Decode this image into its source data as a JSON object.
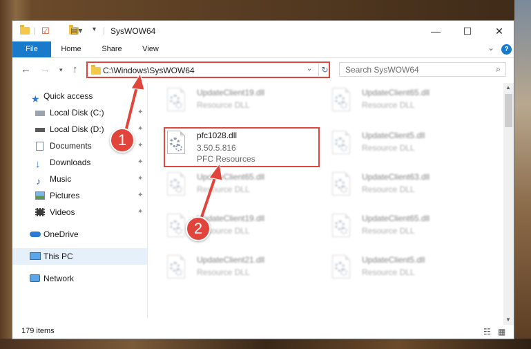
{
  "window": {
    "title": "SysWOW64",
    "controls": {
      "minimize": "—",
      "maximize": "☐",
      "close": "✕"
    }
  },
  "ribbon": {
    "tabs": [
      "File",
      "Home",
      "Share",
      "View"
    ],
    "help": "?",
    "collapse": "⌄"
  },
  "address": {
    "path": "C:\\Windows\\SysWOW64",
    "refresh": "↻",
    "dropdown": "⌄"
  },
  "search": {
    "placeholder": "Search SysWOW64",
    "icon": "⌕"
  },
  "sidebar": {
    "items": [
      {
        "label": "Quick access",
        "icon": "star-icon",
        "pinned": false
      },
      {
        "label": "Local Disk (C:)",
        "icon": "drive-icon",
        "pinned": true
      },
      {
        "label": "Local Disk (D:)",
        "icon": "drive-icon",
        "pinned": true
      },
      {
        "label": "Documents",
        "icon": "documents-icon",
        "pinned": true
      },
      {
        "label": "Downloads",
        "icon": "download-icon",
        "pinned": true
      },
      {
        "label": "Music",
        "icon": "music-icon",
        "pinned": true
      },
      {
        "label": "Pictures",
        "icon": "pictures-icon",
        "pinned": true
      },
      {
        "label": "Videos",
        "icon": "videos-icon",
        "pinned": true
      },
      {
        "label": "OneDrive",
        "icon": "onedrive-icon",
        "pinned": false
      },
      {
        "label": "This PC",
        "icon": "computer-icon",
        "pinned": false,
        "selected": true
      },
      {
        "label": "Network",
        "icon": "network-icon",
        "pinned": false
      }
    ],
    "pin_glyph": "📌"
  },
  "files": {
    "col1": [
      {
        "name": "UpdateClient19.dll",
        "type": "Resource DLL",
        "blurred": true
      },
      {
        "name": "pfc1028.dll",
        "version": "3.50.5.816",
        "type": "PFC Resources",
        "blurred": false
      },
      {
        "name": "UpdateClient65.dll",
        "type": "Resource DLL",
        "blurred": true
      },
      {
        "name": "UpdateClient19.dll",
        "type": "Resource DLL",
        "blurred": true
      },
      {
        "name": "UpdateClient21.dll",
        "type": "Resource DLL",
        "blurred": true
      }
    ],
    "col2": [
      {
        "name": "UpdateClient65.dll",
        "type": "Resource DLL",
        "blurred": true
      },
      {
        "name": "UpdateClient5.dll",
        "type": "Resource DLL",
        "blurred": true
      },
      {
        "name": "UpdateClient63.dll",
        "type": "Resource DLL",
        "blurred": true
      },
      {
        "name": "UpdateClient65.dll",
        "type": "Resource DLL",
        "blurred": true
      },
      {
        "name": "UpdateClient5.dll",
        "type": "Resource DLL",
        "blurred": true
      }
    ]
  },
  "status": {
    "item_count": "179 items"
  },
  "annotations": {
    "step1": "1",
    "step2": "2",
    "color": "#e0443a"
  },
  "colors": {
    "accent": "#1979ca",
    "highlight": "#e0443a",
    "selected_bg": "#e5f0fb"
  }
}
